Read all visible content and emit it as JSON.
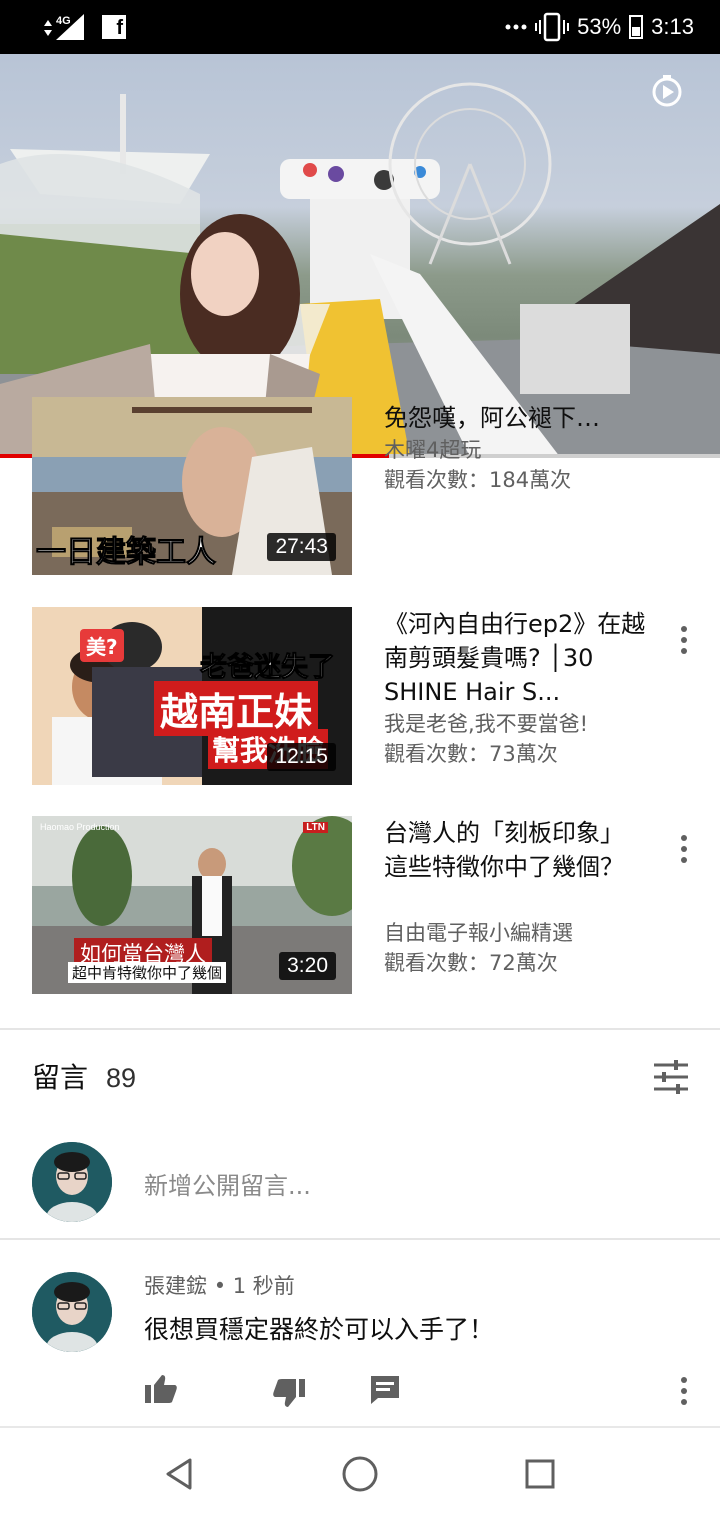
{
  "status_bar": {
    "network": "4G",
    "battery_percent": "53%",
    "time": "3:13",
    "icons": [
      "signal-icon",
      "facebook-icon",
      "more-icon",
      "vibrate-icon",
      "battery-icon"
    ]
  },
  "player": {
    "progress_fraction": 0.54,
    "accent_color": "#e10000",
    "icon": "timer-icon"
  },
  "related": [
    {
      "title": "免怨嘆，阿公褪下…",
      "channel": "木曜4超玩",
      "views": "觀看次數：184萬次",
      "duration": "27:43",
      "thumb_caption": "一日建築工人"
    },
    {
      "title": "《河內自由行ep2》在越南剪頭髮貴嗎? │30 SHINE Hair S...",
      "channel": "我是老爸,我不要當爸!",
      "views": "觀看次數：73萬次",
      "duration": "12:15",
      "thumb_tag": "美?",
      "thumb_line1": "老爸迷失了",
      "thumb_line2": "越南正妹",
      "thumb_line3": "幫我洗臉"
    },
    {
      "title": "台灣人的「刻板印象」 這些特徵你中了幾個？",
      "channel": "自由電子報小編精選",
      "views": "觀看次數：72萬次",
      "duration": "3:20",
      "thumb_brand": "Haomao Production",
      "thumb_logo": "LTN",
      "thumb_caption": "如何當台灣人",
      "thumb_subcaption": "超中肯特徵你中了幾個"
    }
  ],
  "comments": {
    "title": "留言",
    "count": "89",
    "add_placeholder": "新增公開留言...",
    "items": [
      {
        "author": "張建鋐",
        "time": "1 秒前",
        "text": "很想買穩定器終於可以入手了！"
      }
    ]
  },
  "navbar": {
    "icons": [
      "back-icon",
      "home-icon",
      "recents-icon"
    ]
  }
}
